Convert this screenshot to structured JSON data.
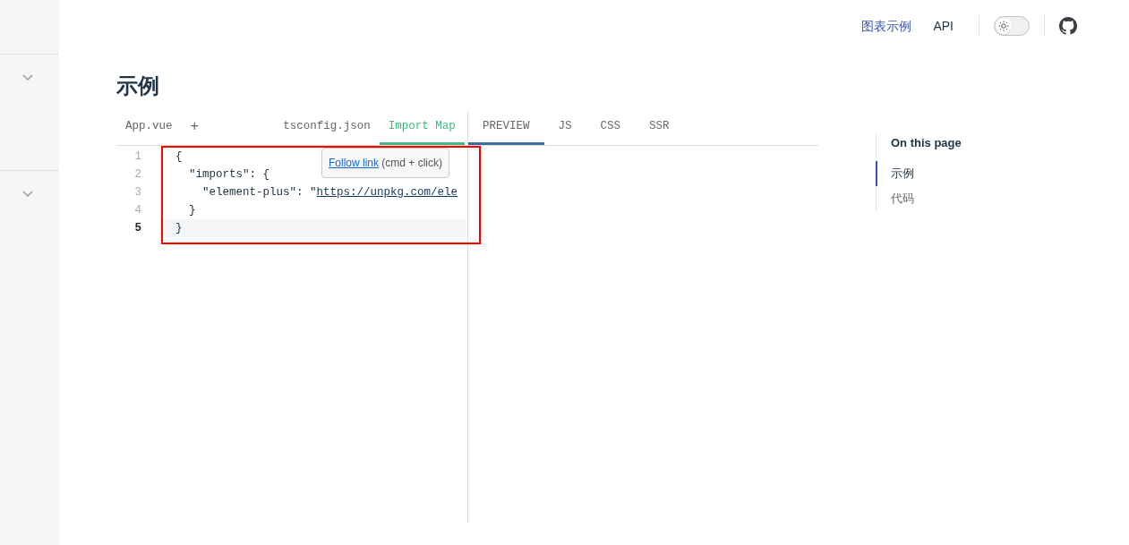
{
  "nav": {
    "links": [
      {
        "label": "图表示例",
        "selected": true
      },
      {
        "label": "API",
        "selected": false
      }
    ],
    "theme_switch": {
      "on": false
    }
  },
  "sidebar": {
    "groups": [
      {
        "expanded": false
      },
      {
        "expanded": false
      }
    ]
  },
  "heading": "示例",
  "editor": {
    "file_tabs": [
      {
        "label": "App.vue",
        "selected": false
      },
      {
        "label": "tsconfig.json",
        "selected": false
      },
      {
        "label": "Import Map",
        "selected": true
      }
    ],
    "add_label": "+",
    "lines": [
      {
        "number": "1",
        "active": false,
        "segments": [
          {
            "text": "{",
            "kind": "punct"
          }
        ]
      },
      {
        "number": "2",
        "active": false,
        "segments": [
          {
            "text": "\"imports\"",
            "kind": "key"
          },
          {
            "text": ": {",
            "kind": "punct"
          }
        ]
      },
      {
        "number": "3",
        "active": false,
        "segments": [
          {
            "text": "\"element-plus\"",
            "kind": "key"
          },
          {
            "text": ": ",
            "kind": "punct"
          },
          {
            "text": "\"",
            "kind": "string"
          },
          {
            "text": "https://unpkg.com/ele",
            "kind": "link"
          }
        ]
      },
      {
        "number": "4",
        "active": false,
        "segments": [
          {
            "text": "}",
            "kind": "punct"
          }
        ]
      },
      {
        "number": "5",
        "active": true,
        "segments": [
          {
            "text": "}",
            "kind": "punct"
          }
        ]
      }
    ],
    "tooltip": {
      "link": "Follow link",
      "hint": "(cmd + click)"
    }
  },
  "output_tabs": [
    {
      "label": "PREVIEW",
      "selected": true
    },
    {
      "label": "JS",
      "selected": false
    },
    {
      "label": "CSS",
      "selected": false
    },
    {
      "label": "SSR",
      "selected": false
    }
  ],
  "toc": {
    "title": "On this page",
    "items": [
      {
        "label": "示例",
        "selected": true
      },
      {
        "label": "代码",
        "selected": false
      }
    ]
  }
}
